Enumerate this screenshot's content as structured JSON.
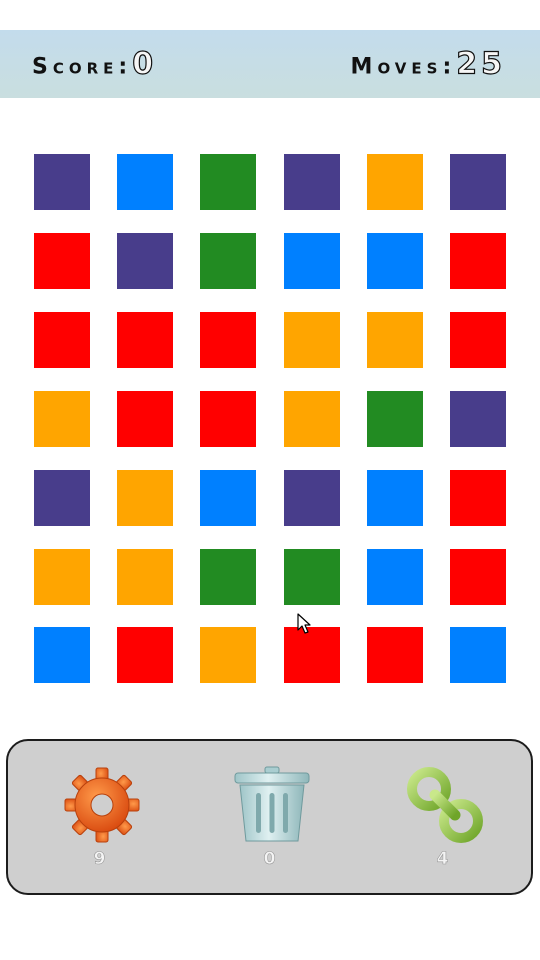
{
  "hud": {
    "score_label": "Score:",
    "score_value": "0",
    "moves_label": "Moves:",
    "moves_value": "25"
  },
  "palette": {
    "purple": "#483D8B",
    "blue": "#0080FF",
    "green": "#228B22",
    "orange": "#FFA500",
    "red": "#FF0000"
  },
  "board": {
    "rows": 7,
    "cols": 6,
    "grid": [
      [
        "purple",
        "blue",
        "green",
        "purple",
        "orange",
        "purple"
      ],
      [
        "red",
        "purple",
        "green",
        "blue",
        "blue",
        "red"
      ],
      [
        "red",
        "red",
        "red",
        "orange",
        "orange",
        "red"
      ],
      [
        "orange",
        "red",
        "red",
        "orange",
        "green",
        "purple"
      ],
      [
        "purple",
        "orange",
        "blue",
        "purple",
        "blue",
        "red"
      ],
      [
        "orange",
        "orange",
        "green",
        "green",
        "blue",
        "red"
      ],
      [
        "blue",
        "red",
        "orange",
        "red",
        "red",
        "blue"
      ]
    ]
  },
  "tools": [
    {
      "name": "gear-icon",
      "count": "9"
    },
    {
      "name": "trash-icon",
      "count": "0"
    },
    {
      "name": "chain-link-icon",
      "count": "4"
    }
  ]
}
